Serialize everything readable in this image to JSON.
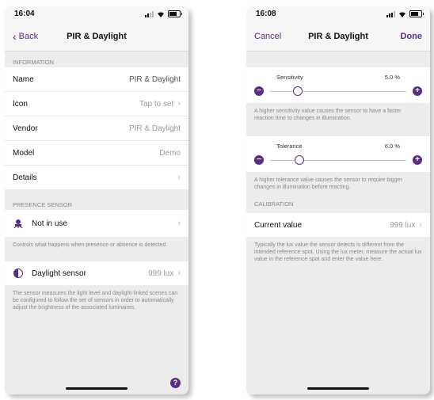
{
  "colors": {
    "accent": "#5a2d86",
    "background": "#ececec"
  },
  "left": {
    "time": "16:04",
    "back_label": "Back",
    "title": "PIR & Daylight",
    "information_header": "INFORMATION",
    "rows": [
      {
        "label": "Name",
        "value": "PIR & Daylight",
        "chevron": false
      },
      {
        "label": "Icon",
        "value": "Tap to set",
        "chevron": true
      },
      {
        "label": "Vendor",
        "value": "PIR & Daylight",
        "chevron": false
      },
      {
        "label": "Model",
        "value": "Demo",
        "chevron": false
      },
      {
        "label": "Details",
        "value": "",
        "chevron": true
      }
    ],
    "presence_header": "PRESENCE SENSOR",
    "presence_row": {
      "label": "Not in use",
      "icon": "motion-sensor-icon"
    },
    "presence_note": "Controls what happens when presence or absence is detected.",
    "daylight_row": {
      "label": "Daylight sensor",
      "value": "999 lux",
      "icon": "daylight-sensor-icon"
    },
    "daylight_note": "The sensor measures the light level and daylight-linked scenes can be configured to follow the set of sensors in order to automatically adjust the brightness of the associated luminaires.",
    "help_label": "?"
  },
  "right": {
    "time": "16:08",
    "cancel_label": "Cancel",
    "title": "PIR & Daylight",
    "done_label": "Done",
    "sensitivity": {
      "label": "Sensitivity",
      "value": "5.0 %",
      "level": 0.05
    },
    "sensitivity_note": "A higher sensitivity value causes the sensor to have a faster reaction time to changes in illumination.",
    "tolerance": {
      "label": "Tolerance",
      "value": "6.0 %",
      "level": 0.06
    },
    "tolerance_note": "A higher tolerance value causes the sensor to require bigger changes in illumination before reacting.",
    "calibration_header": "CALIBRATION",
    "current_value_row": {
      "label": "Current value",
      "value": "999 lux"
    },
    "calibration_note": "Typically the lux value the sensor detects is different from the intended reference spot. Using the lux meter, measure the actual lux value in the reference spot and enter the value here."
  }
}
